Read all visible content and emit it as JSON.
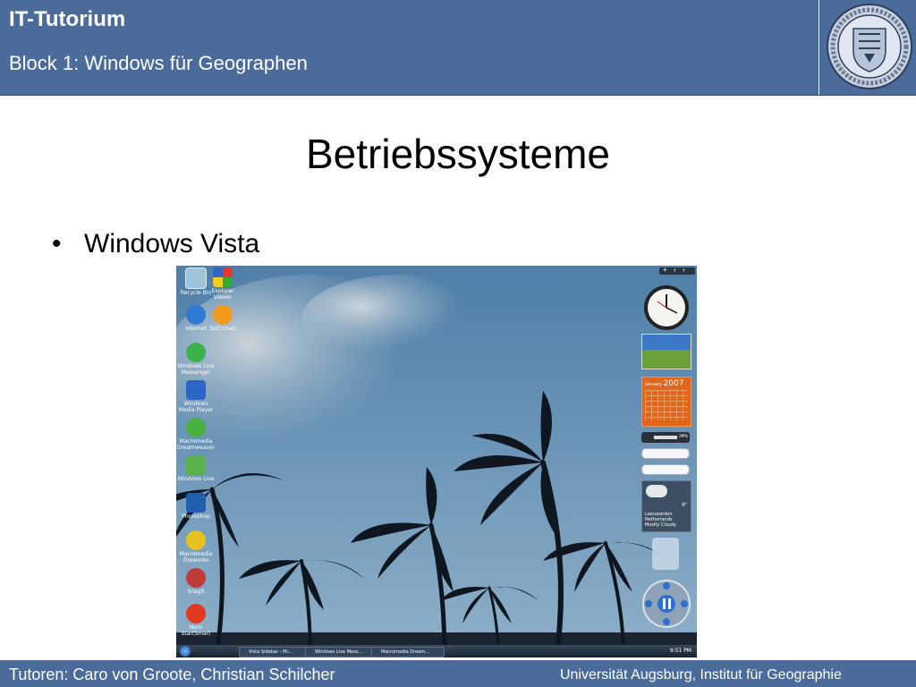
{
  "header": {
    "title": "IT-Tutorium",
    "subtitle": "Block 1: Windows für Geographen",
    "seal_text": "UNIVERSITAT AUGSBURG · SCIENTIA ET CONSCIENTIA"
  },
  "slide": {
    "title": "Betriebssysteme",
    "bullet": "Windows Vista",
    "bullet_marker": "•"
  },
  "screenshot": {
    "desktop_icons": [
      {
        "label": "Recycle Bin",
        "icon": "recycle-bin-icon"
      },
      {
        "label": "Explorer Viewer",
        "icon": "windows-flag-icon"
      },
      {
        "label": "Internet",
        "icon": "internet-explorer-icon"
      },
      {
        "label": "SolComet",
        "icon": "app-icon"
      },
      {
        "label": "Windows Live Messenger",
        "icon": "messenger-icon"
      },
      {
        "label": "Windows Media Player",
        "icon": "media-player-icon"
      },
      {
        "label": "Macromedia Dreamweaver",
        "icon": "dreamweaver-icon"
      },
      {
        "label": "Windows Live",
        "icon": "windows-live-icon"
      },
      {
        "label": "Photoshop",
        "icon": "photoshop-icon"
      },
      {
        "label": "Macromedia Fireworks",
        "icon": "fireworks-icon"
      },
      {
        "label": "SnagIt",
        "icon": "snagit-icon"
      },
      {
        "label": "Nero StartSmart",
        "icon": "nero-icon"
      }
    ],
    "sidebar": {
      "calendar_month": "January",
      "calendar_year": "2007",
      "cpu_percent": "34%",
      "weather_temp": "8°",
      "weather_city": "Leeuwarden",
      "weather_country": "Netherlands",
      "weather_desc": "Mostly Cloudy"
    },
    "taskbar": {
      "buttons": [
        "Vista Sidebar - Mi...",
        "Windows Live Mess...",
        "Macromedia Dream..."
      ],
      "clock": "9:51 PM"
    }
  },
  "footer": {
    "left": "Tutoren: Caro von Groote, Christian Schilcher",
    "right": "Universität Augsburg, Institut für Geographie"
  }
}
